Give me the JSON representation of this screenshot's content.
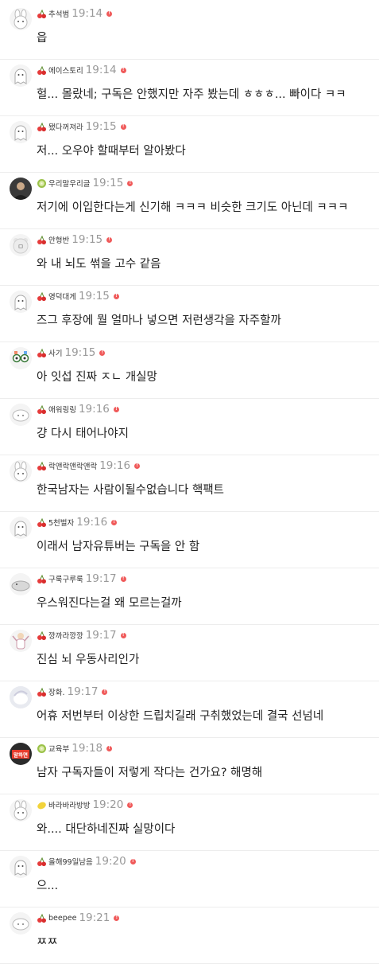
{
  "colors": {
    "badge_cherry": "#e63b3b",
    "badge_kiwi": "#9bc24a",
    "badge_lemon": "#f2d33a",
    "dot": "#f05a5a",
    "time": "#999999",
    "text": "#222222"
  },
  "messages": [
    {
      "user": "추석범",
      "time": "19:14",
      "text": "읍",
      "badge": "cherry-icon",
      "avatar": "bunny-avatar-icon"
    },
    {
      "user": "에이스토리",
      "time": "19:14",
      "text": "헐... 몰랐네; 구독은 안했지만 자주 봤는데 ㅎㅎㅎ... 빠이다 ㅋㅋ",
      "badge": "cherry-icon",
      "avatar": "ghost-avatar-icon"
    },
    {
      "user": "됐다꺼져라",
      "time": "19:15",
      "text": "저... 오우야 할때부터 알아봤다",
      "badge": "cherry-icon",
      "avatar": "ghost-avatar-icon"
    },
    {
      "user": "우리말우리글",
      "time": "19:15",
      "text": "저기에 이입한다는게 신기해 ㅋㅋㅋ 비슷한 크기도 아닌데 ㅋㅋㅋ",
      "badge": "kiwi-icon",
      "avatar": "photo-avatar-icon"
    },
    {
      "user": "안형반",
      "time": "19:15",
      "text": "와 내 뇌도 썪을 고수 같음",
      "badge": "cherry-icon",
      "avatar": "bear-avatar-icon"
    },
    {
      "user": "영덕대게",
      "time": "19:15",
      "text": "즈그 후장에 뭘 얼마나 넣으면 저런생각을 자주할까",
      "badge": "cherry-icon",
      "avatar": "ghost-avatar-icon"
    },
    {
      "user": "사기",
      "time": "19:15",
      "text": "아 잇섭 진짜 ㅈㄴ 개실망",
      "badge": "cherry-icon",
      "avatar": "glasses-avatar-icon"
    },
    {
      "user": "애워링링",
      "time": "19:16",
      "text": "걍 다시 태어나야지",
      "badge": "cherry-icon",
      "avatar": "cloud-avatar-icon"
    },
    {
      "user": "락앤락앤락앤락",
      "time": "19:16",
      "text": "한국남자는 사람이될수없습니다 핵팩트",
      "badge": "cherry-icon",
      "avatar": "bunny-avatar-icon"
    },
    {
      "user": "5천벌자",
      "time": "19:16",
      "text": "이래서 남자유튜버는 구독을 안 함",
      "badge": "cherry-icon",
      "avatar": "ghost-avatar-icon"
    },
    {
      "user": "구룩구루룩",
      "time": "19:17",
      "text": "우스워진다는걸 왜 모르는걸까",
      "badge": "cherry-icon",
      "avatar": "seal-avatar-icon"
    },
    {
      "user": "깡까라깡깡",
      "time": "19:17",
      "text": "진심 뇌 우동사리인가",
      "badge": "cherry-icon",
      "avatar": "figure-avatar-icon"
    },
    {
      "user": "장화.",
      "time": "19:17",
      "text": "어휴 저번부터 이상한 드립치길래 구취했었는데 결국 선넘네",
      "badge": "cherry-icon",
      "avatar": "bird-avatar-icon"
    },
    {
      "user": "교육부",
      "time": "19:18",
      "text": "남자 구독자들이 저렇게 작다는 건가요? 해명해",
      "badge": "kiwi-icon",
      "avatar": "label-avatar-icon",
      "avatar_label": "말하면\n안돼"
    },
    {
      "user": "바라바라방방",
      "time": "19:20",
      "text": "와.... 대단하네진짜 실망이다",
      "badge": "lemon-icon",
      "avatar": "bunny-avatar-icon"
    },
    {
      "user": "올해99일남음",
      "time": "19:20",
      "text": "으...",
      "badge": "cherry-icon",
      "avatar": "ghost-avatar-icon"
    },
    {
      "user": "beepee",
      "time": "19:21",
      "text": "ㅉㅉ",
      "badge": "cherry-icon",
      "avatar": "cloud-avatar-icon"
    }
  ]
}
